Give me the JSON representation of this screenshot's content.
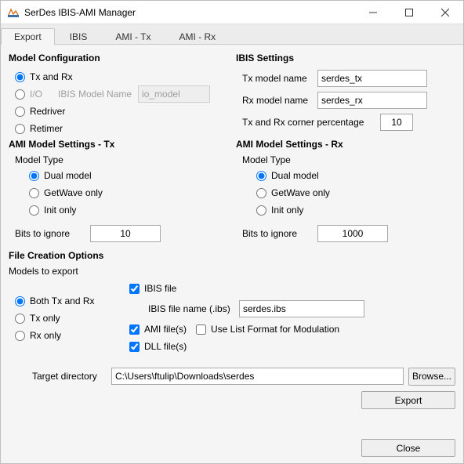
{
  "window": {
    "title": "SerDes IBIS-AMI Manager"
  },
  "tabs": {
    "export": "Export",
    "ibis": "IBIS",
    "amitx": "AMI - Tx",
    "amirx": "AMI - Rx"
  },
  "modelConfig": {
    "title": "Model Configuration",
    "tx_rx": "Tx and Rx",
    "io": "I/O",
    "ibis_model_name_label": "IBIS Model Name",
    "ibis_model_name_value": "io_model",
    "redriver": "Redriver",
    "retimer": "Retimer"
  },
  "ibisSettings": {
    "title": "IBIS Settings",
    "tx_label": "Tx model name",
    "tx_value": "serdes_tx",
    "rx_label": "Rx model name",
    "rx_value": "serdes_rx",
    "corner_label": "Tx and Rx corner percentage",
    "corner_value": "10"
  },
  "amiTx": {
    "title": "AMI Model Settings - Tx",
    "model_type": "Model Type",
    "dual": "Dual model",
    "getwave": "GetWave only",
    "init": "Init only",
    "bits_label": "Bits to ignore",
    "bits_value": "10"
  },
  "amiRx": {
    "title": "AMI Model Settings - Rx",
    "model_type": "Model Type",
    "dual": "Dual model",
    "getwave": "GetWave only",
    "init": "Init only",
    "bits_label": "Bits to ignore",
    "bits_value": "1000"
  },
  "fileCreation": {
    "title": "File Creation Options",
    "models_to_export": "Models to export",
    "both": "Both Tx and Rx",
    "txonly": "Tx only",
    "rxonly": "Rx only",
    "ibis_file": "IBIS file",
    "ibis_filename_label": "IBIS file name (.ibs)",
    "ibis_filename_value": "serdes.ibs",
    "ami_files": "AMI file(s)",
    "use_list": "Use List Format for Modulation",
    "dll_files": "DLL file(s)",
    "target_dir_label": "Target directory",
    "target_dir_value": "C:\\Users\\ftulip\\Downloads\\serdes",
    "browse": "Browse..."
  },
  "footer": {
    "export": "Export",
    "close": "Close"
  }
}
